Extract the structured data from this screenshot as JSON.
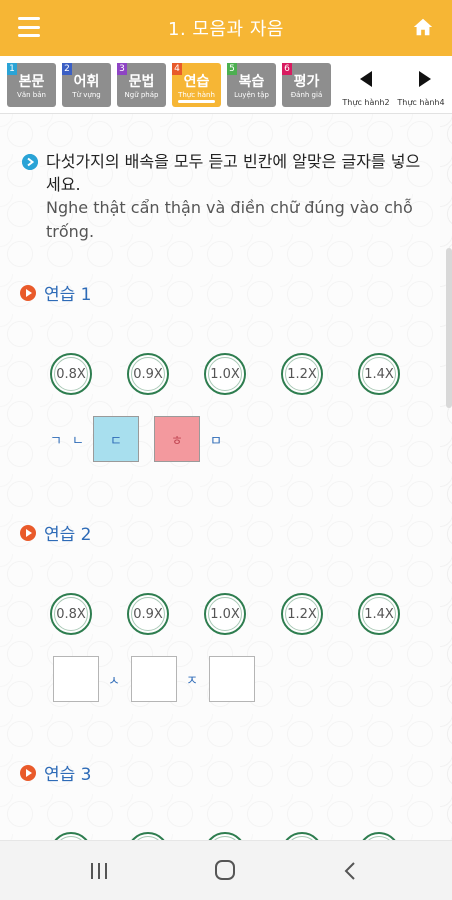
{
  "header": {
    "title": "1. 모음과 자음"
  },
  "tabs": [
    {
      "num": "1",
      "ko": "본문",
      "vi": "Văn bản",
      "num_color": "#2aa3d6",
      "active": false
    },
    {
      "num": "2",
      "ko": "어휘",
      "vi": "Từ vựng",
      "num_color": "#3b5fc4",
      "active": false
    },
    {
      "num": "3",
      "ko": "문법",
      "vi": "Ngữ pháp",
      "num_color": "#8e44c4",
      "active": false
    },
    {
      "num": "4",
      "ko": "연습",
      "vi": "Thực hành",
      "num_color": "#e85a2a",
      "active": true
    },
    {
      "num": "5",
      "ko": "복습",
      "vi": "Luyện tập",
      "num_color": "#4caf50",
      "active": false
    },
    {
      "num": "6",
      "ko": "평가",
      "vi": "Đánh giá",
      "num_color": "#d81b60",
      "active": false
    }
  ],
  "nav": {
    "prev_label": "Thực hành2",
    "next_label": "Thực hành4"
  },
  "instruction": {
    "ko": "다섯가지의 배속을 모두 듣고 빈칸에 알맞은 글자를 넣으세요.",
    "vi": "Nghe thật cẩn thận và điền chữ đúng vào chỗ trống."
  },
  "sections": [
    {
      "label": "연습 1",
      "speeds": [
        "0.8X",
        "0.9X",
        "1.0X",
        "1.2X",
        "1.4X"
      ],
      "row": {
        "jamo_1": "ㄱ",
        "jamo_2": "ㄴ",
        "box_blue": "ㄷ",
        "box_pink": "ㅎ",
        "jamo_3": "ㅁ"
      }
    },
    {
      "label": "연습 2",
      "speeds": [
        "0.8X",
        "0.9X",
        "1.0X",
        "1.2X",
        "1.4X"
      ],
      "row": {
        "jamo_1": "ㅅ",
        "jamo_2": "ㅈ"
      }
    },
    {
      "label": "연습 3"
    }
  ],
  "colors": {
    "accent": "#f6b635",
    "tab_inactive": "#8e8e8e",
    "label_blue": "#2e6bb7",
    "play_orange": "#e95a2a",
    "speed_ring": "#2e7d4f",
    "box_blue": "#a8dfee",
    "box_pink": "#f3999e"
  },
  "icons": {
    "menu": "hamburger-menu-icon",
    "home": "home-icon",
    "prev": "triangle-left-icon",
    "next": "triangle-right-icon",
    "info": "info-bullet-icon",
    "play": "play-icon",
    "recents": "recent-apps-icon",
    "home_nav": "home-circle-icon",
    "back": "back-chevron-icon"
  }
}
